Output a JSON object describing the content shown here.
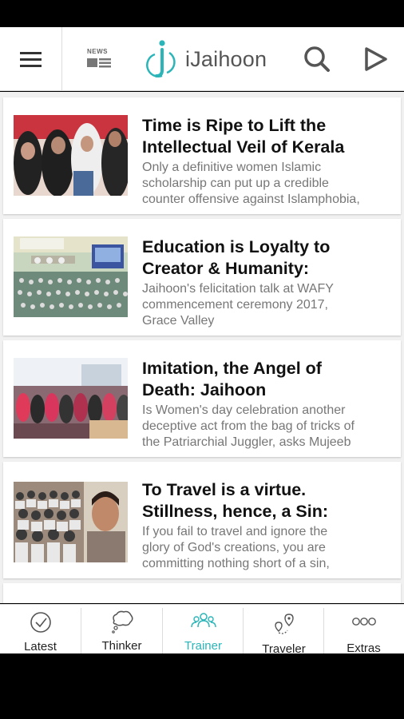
{
  "header": {
    "news_label": "NEWS",
    "brand_name": "iJaihoon",
    "accent_color": "#2bb5b8"
  },
  "articles": [
    {
      "title": "Time is Ripe to Lift the\nIntellectual Veil of Kerala",
      "summary": "Only a definitive women Islamic\nscholarship can put up a credible\ncounter offensive against Islamphobia,"
    },
    {
      "title": "Education is Loyalty to\nCreator & Humanity:",
      "summary": "Jaihoon's felicitation talk at WAFY\ncommencement ceremony 2017,\nGrace Valley"
    },
    {
      "title": "Imitation, the Angel of\nDeath: Jaihoon",
      "summary": "Is Women's day celebration another\ndeceptive act from the bag of tricks of\nthe Patriarchial Juggler, asks Mujeeb"
    },
    {
      "title": "To Travel is a virtue.\nStillness, hence, a Sin:",
      "summary": "If you fail to travel and ignore the\nglory of God's creations, you are\ncommitting nothing short of a sin,"
    }
  ],
  "tabs": [
    {
      "label": "Latest",
      "icon": "clock-icon",
      "active": false
    },
    {
      "label": "Thinker",
      "icon": "thought-bubble-icon",
      "active": false
    },
    {
      "label": "Trainer",
      "icon": "group-icon",
      "active": true
    },
    {
      "label": "Traveler",
      "icon": "map-pin-icon",
      "active": false
    },
    {
      "label": "Extras",
      "icon": "more-dots-icon",
      "active": false
    }
  ]
}
